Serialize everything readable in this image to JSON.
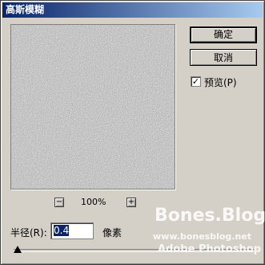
{
  "dialog": {
    "title": "高斯模糊",
    "ok_label": "确定",
    "cancel_label": "取消",
    "preview_label": "预览(P)",
    "preview_checked": true
  },
  "zoom": {
    "minus": "−",
    "plus": "+",
    "level": "100%"
  },
  "radius": {
    "label": "半径(R):",
    "value": "0.4",
    "unit": "像素"
  },
  "watermark": {
    "line1": "Bones.Blog",
    "line2": "www.bonesblog.net",
    "line3": "Adobe Photoshop"
  }
}
